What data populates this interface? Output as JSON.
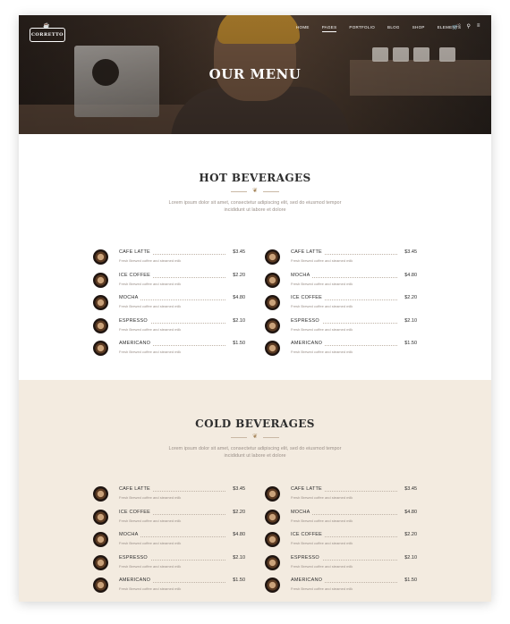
{
  "header": {
    "logo_text": "CORRETTO",
    "nav": [
      "HOME",
      "PAGES",
      "PORTFOLIO",
      "BLOG",
      "SHOP",
      "ELEMENTS"
    ],
    "active_nav": "PAGES",
    "cart_count": "0",
    "icons": [
      "cart-icon",
      "search-icon",
      "menu-icon"
    ]
  },
  "hero": {
    "title": "OUR MENU"
  },
  "sections": [
    {
      "title": "HOT BEVERAGES",
      "description": "Lorem ipsum dolor sit amet, consectetur adipiscing elit, sed do eiusmod tempor incididunt ut labore et dolore",
      "left": [
        {
          "name": "CAFE LATTE",
          "desc": "Fresh Brewed coffee and steamed milk",
          "price": "$3.45"
        },
        {
          "name": "ICE COFFEE",
          "desc": "Fresh Brewed coffee and steamed milk",
          "price": "$2.20"
        },
        {
          "name": "MOCHA",
          "desc": "Fresh Brewed coffee and steamed milk",
          "price": "$4.80"
        },
        {
          "name": "ESPRESSO",
          "desc": "Fresh Brewed coffee and steamed milk",
          "price": "$2.10"
        },
        {
          "name": "AMERICANO",
          "desc": "Fresh Brewed coffee and steamed milk",
          "price": "$1.50"
        }
      ],
      "right": [
        {
          "name": "CAFE LATTE",
          "desc": "Fresh Brewed coffee and steamed milk",
          "price": "$3.45"
        },
        {
          "name": "MOCHA",
          "desc": "Fresh Brewed coffee and steamed milk",
          "price": "$4.80"
        },
        {
          "name": "ICE COFFEE",
          "desc": "Fresh Brewed coffee and steamed milk",
          "price": "$2.20"
        },
        {
          "name": "ESPRESSO",
          "desc": "Fresh Brewed coffee and steamed milk",
          "price": "$2.10"
        },
        {
          "name": "AMERICANO",
          "desc": "Fresh Brewed coffee and steamed milk",
          "price": "$1.50"
        }
      ]
    },
    {
      "title": "COLD BEVERAGES",
      "description": "Lorem ipsum dolor sit amet, consectetur adipiscing elit, sed do eiusmod tempor incididunt ut labore et dolore",
      "left": [
        {
          "name": "CAFE LATTE",
          "desc": "Fresh Brewed coffee and steamed milk",
          "price": "$3.45"
        },
        {
          "name": "ICE COFFEE",
          "desc": "Fresh Brewed coffee and steamed milk",
          "price": "$2.20"
        },
        {
          "name": "MOCHA",
          "desc": "Fresh Brewed coffee and steamed milk",
          "price": "$4.80"
        },
        {
          "name": "ESPRESSO",
          "desc": "Fresh Brewed coffee and steamed milk",
          "price": "$2.10"
        },
        {
          "name": "AMERICANO",
          "desc": "Fresh Brewed coffee and steamed milk",
          "price": "$1.50"
        }
      ],
      "right": [
        {
          "name": "CAFE LATTE",
          "desc": "Fresh Brewed coffee and steamed milk",
          "price": "$3.45"
        },
        {
          "name": "MOCHA",
          "desc": "Fresh Brewed coffee and steamed milk",
          "price": "$4.80"
        },
        {
          "name": "ICE COFFEE",
          "desc": "Fresh Brewed coffee and steamed milk",
          "price": "$2.20"
        },
        {
          "name": "ESPRESSO",
          "desc": "Fresh Brewed coffee and steamed milk",
          "price": "$2.10"
        },
        {
          "name": "AMERICANO",
          "desc": "Fresh Brewed coffee and steamed milk",
          "price": "$1.50"
        }
      ]
    }
  ],
  "colors": {
    "accent": "#a8895f",
    "cold_bg": "#f3ebe0",
    "text": "#2e2e2e",
    "muted": "#9b9089"
  }
}
